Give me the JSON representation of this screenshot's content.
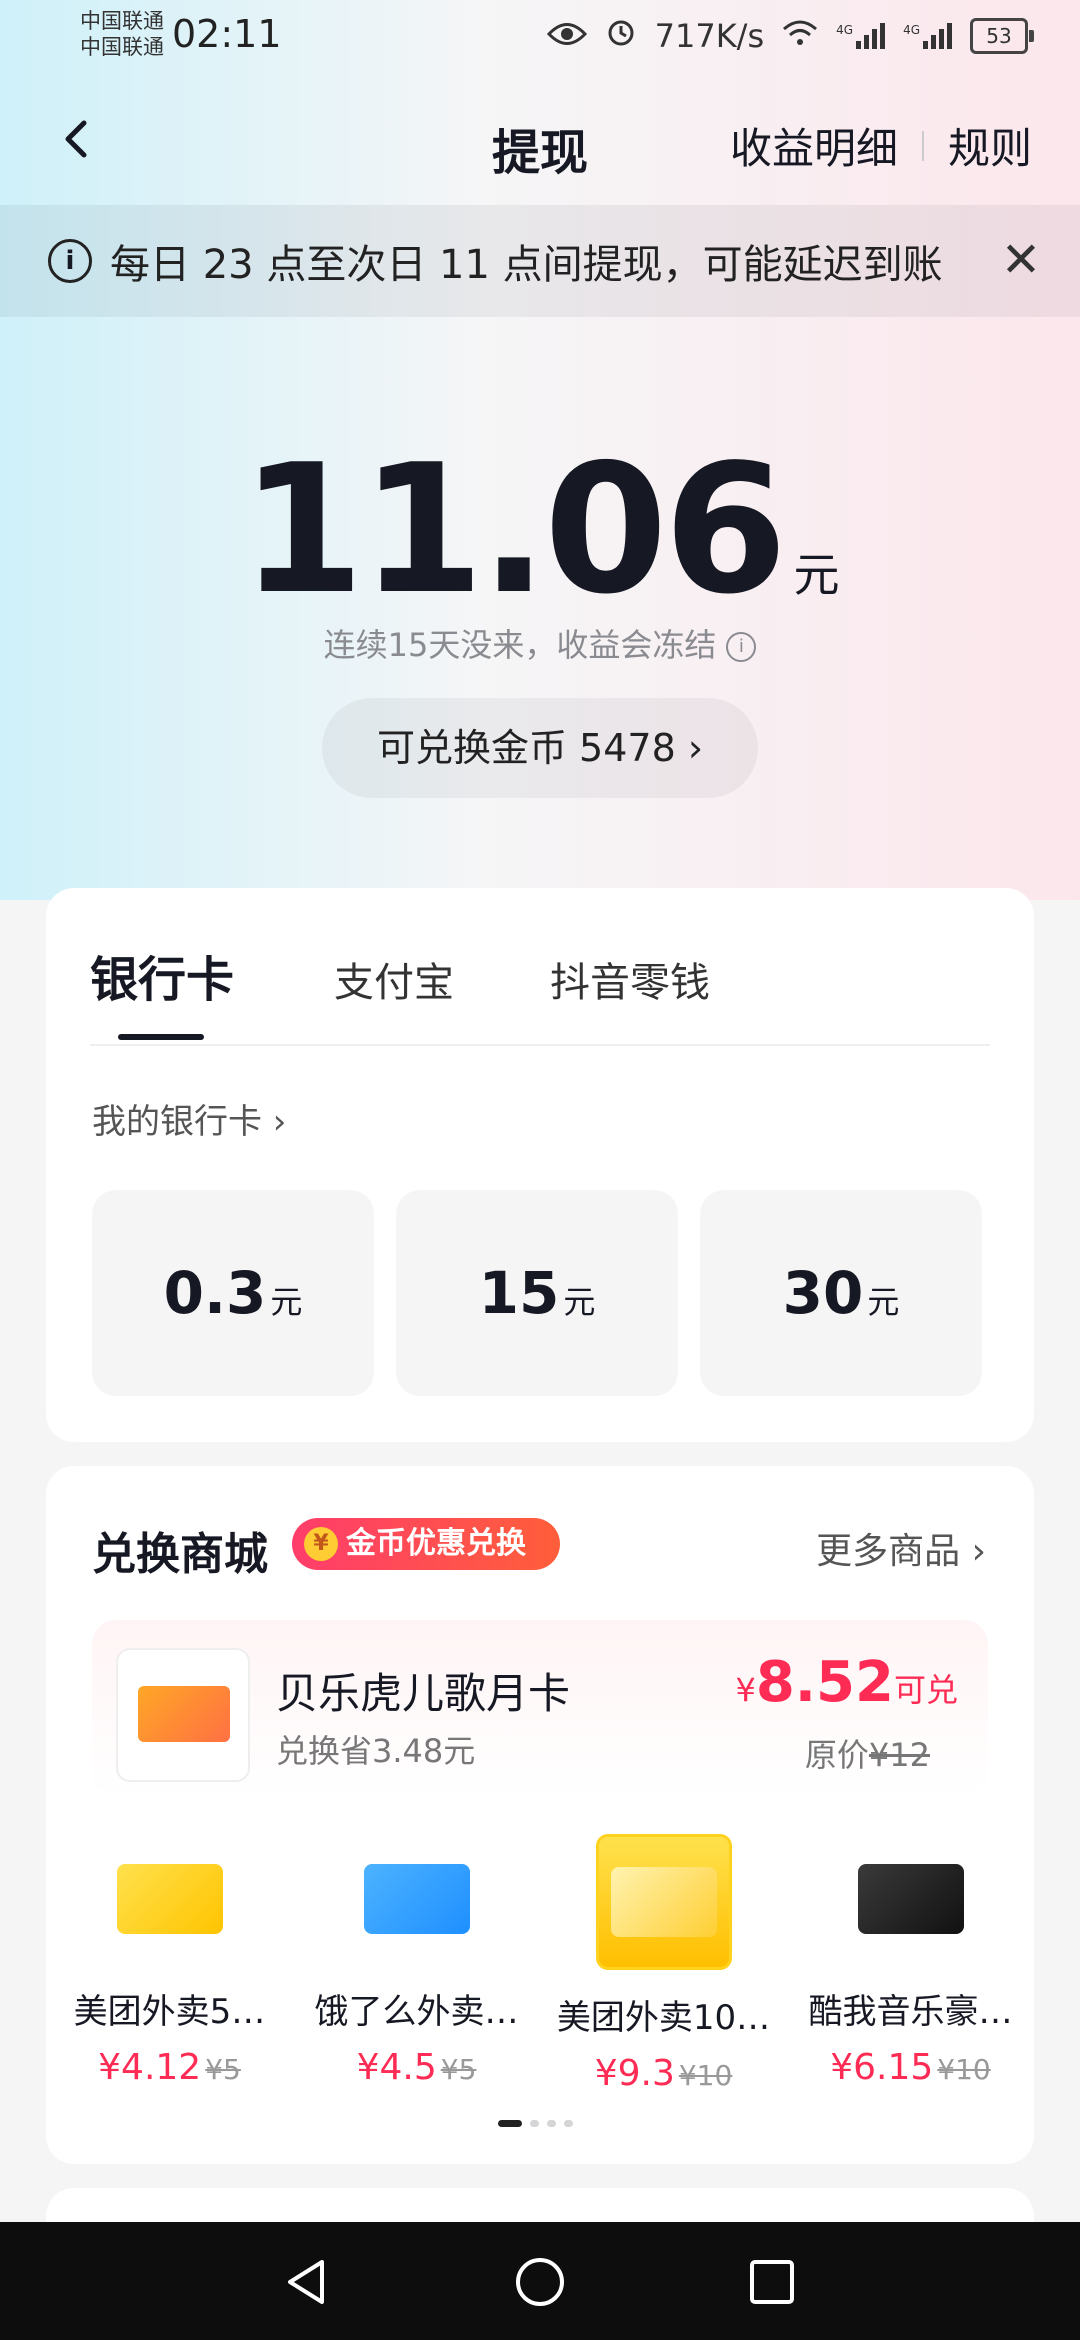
{
  "status_bar": {
    "carrier1": "中国联通",
    "carrier2": "中国联通",
    "time": "02:11",
    "net_speed": "717K/s",
    "battery": "53",
    "net_type1": "4G",
    "net_type2": "4G"
  },
  "nav": {
    "title": "提现",
    "details": "收益明细",
    "rules": "规则"
  },
  "notice": {
    "text": "每日 23 点至次日 11 点间提现，可能延迟到账"
  },
  "balance": {
    "amount": "11.06",
    "unit": "元",
    "freeze_hint": "连续15天没来，收益会冻结",
    "coins_label": "可兑换金币 5478 ›"
  },
  "withdraw": {
    "tabs": [
      "银行卡",
      "支付宝",
      "抖音零钱"
    ],
    "my_cards": "我的银行卡 ›",
    "options": [
      {
        "value": "0.3",
        "unit": "元"
      },
      {
        "value": "15",
        "unit": "元"
      },
      {
        "value": "30",
        "unit": "元"
      }
    ]
  },
  "mall": {
    "title": "兑换商城",
    "badge": "金币优惠兑换",
    "badge_coin": "¥",
    "more": "更多商品 ›",
    "featured": {
      "name": "贝乐虎儿歌月卡",
      "save": "兑换省3.48元",
      "price_symbol": "¥",
      "price": "8.52",
      "price_suffix": "可兑",
      "orig_label": "原价",
      "orig_price": "¥12"
    },
    "items": [
      {
        "name": "美团外卖5…",
        "price": "¥4.12",
        "orig": "¥5"
      },
      {
        "name": "饿了么外卖…",
        "price": "¥4.5",
        "orig": "¥5"
      },
      {
        "name": "美团外卖10…",
        "price": "¥9.3",
        "orig": "¥10"
      },
      {
        "name": "酷我音乐豪…",
        "price": "¥6.15",
        "orig": "¥10"
      }
    ],
    "page_dots": 4,
    "active_dot": 0
  },
  "colors": {
    "accent": "#fe2c55",
    "text": "#161823",
    "meituan_yellow": "#ffd21e",
    "eleme_blue": "#1e8fff",
    "kuwo_dark": "#222222"
  }
}
